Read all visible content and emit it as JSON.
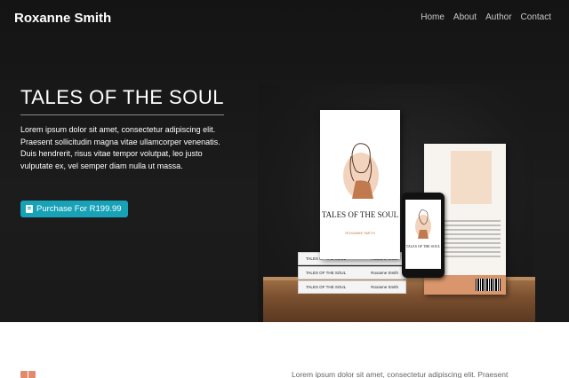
{
  "header": {
    "brand": "Roxanne Smith",
    "nav": [
      "Home",
      "About",
      "Author",
      "Contact"
    ]
  },
  "hero": {
    "title": "TALES OF THE SOUL",
    "description": "Lorem ipsum dolor sit amet, consectetur adipiscing elit. Praesent sollicitudin magna vitae ullamcorper venenatis. Duis hendrerit, risus vitae tempor volutpat, leo justo vulputate ex, vel semper diam nulla ut massa.",
    "button_label": "Purchase For R199.99",
    "button_icon": "book-icon"
  },
  "mockup": {
    "book_title": "TALES OF THE SOUL",
    "book_author": "ROXANNE SMITH",
    "spine_title": "TALES OF THE SOUL",
    "spine_author": "Roxanne Smith"
  },
  "lower": {
    "icon": "open-book-icon",
    "text": "Lorem ipsum dolor sit amet, consectetur adipiscing elit. Praesent"
  },
  "colors": {
    "accent": "#17a2b8",
    "hero_bg": "#1a1a1a",
    "icon_accent": "#e08a6e"
  }
}
